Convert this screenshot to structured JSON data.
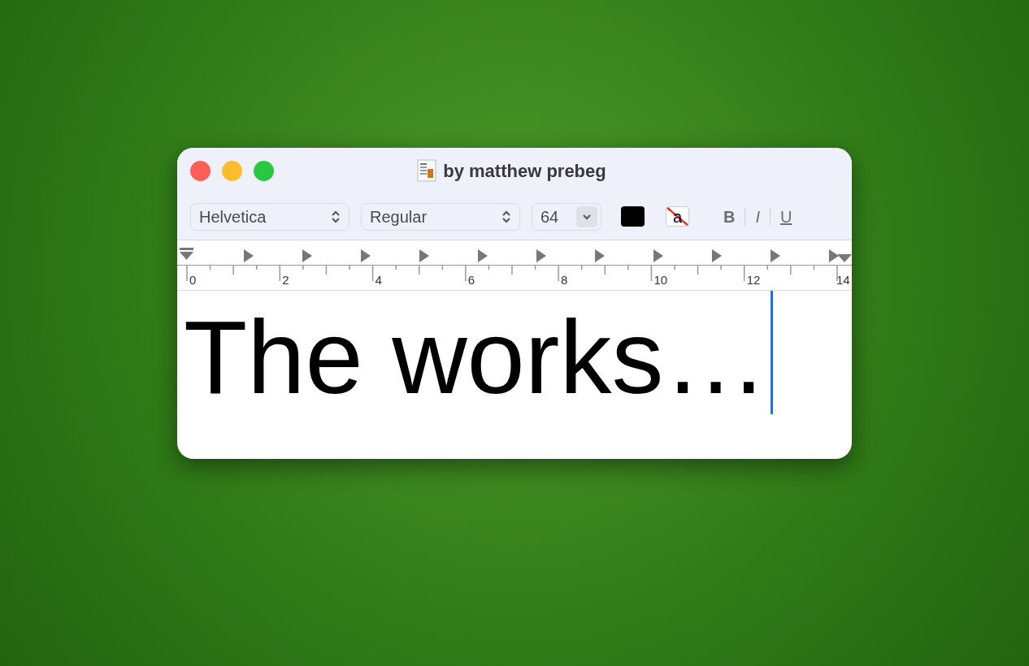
{
  "window": {
    "title": "by matthew prebeg"
  },
  "toolbar": {
    "font_family": "Helvetica",
    "typeface": "Regular",
    "font_size": "64",
    "background_color_label": "a",
    "bold": "B",
    "italic": "I",
    "underline": "U"
  },
  "ruler": {
    "labels": [
      "0",
      "2",
      "4",
      "6",
      "8",
      "10",
      "12",
      "14"
    ]
  },
  "document": {
    "text": "The works…"
  }
}
